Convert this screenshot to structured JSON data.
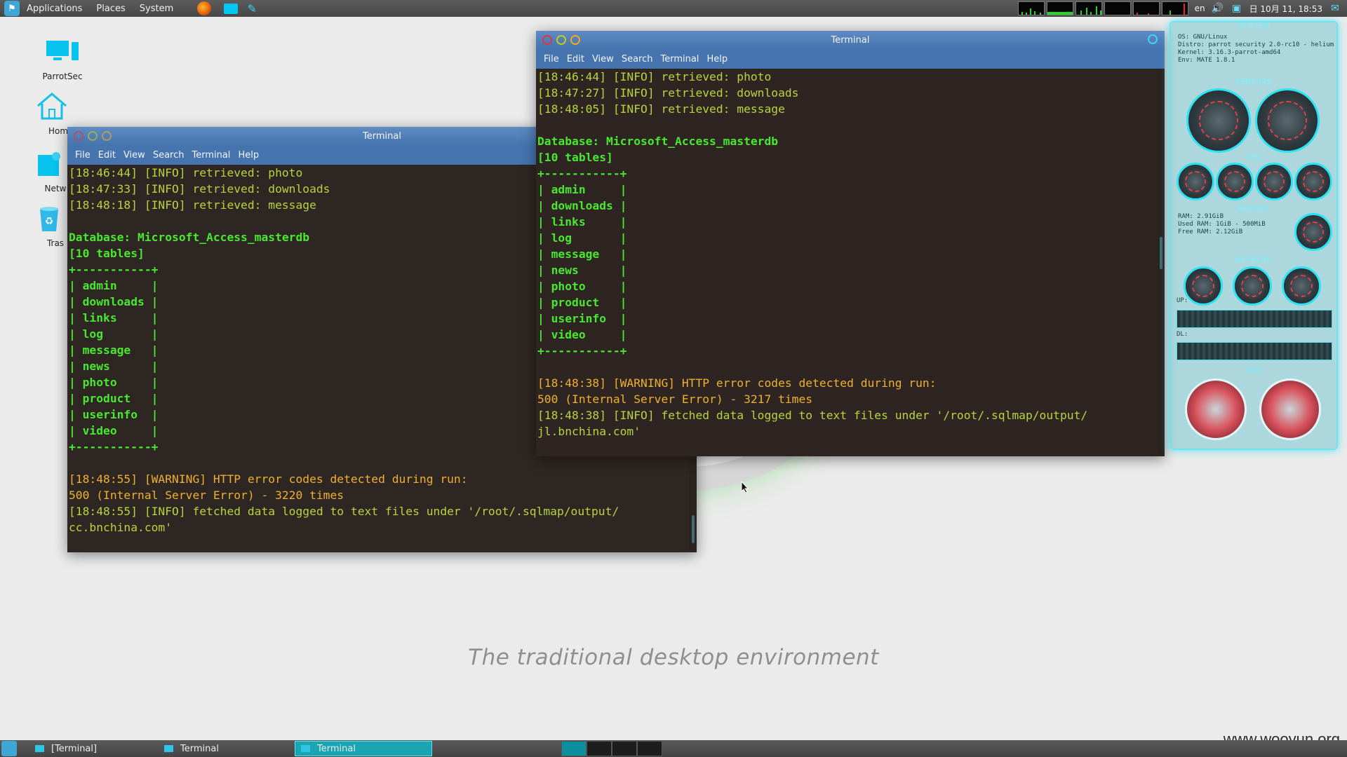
{
  "top_panel": {
    "menus": [
      "Applications",
      "Places",
      "System"
    ],
    "launchers": [
      "firefox-icon",
      "terminal-icon",
      "text-editor-icon"
    ],
    "keyboard_layout": "en",
    "clock": "日 10月 11, 18:53"
  },
  "desktop_icons": [
    {
      "label": "ParrotSec",
      "icon": "computer-icon"
    },
    {
      "label": "Hom",
      "icon": "home-icon"
    },
    {
      "label": "Netw",
      "icon": "network-icon"
    },
    {
      "label": "Tras",
      "icon": "trash-icon"
    }
  ],
  "wallpaper": {
    "tagline": "The traditional desktop environment",
    "watermark": "www.wooyun.org"
  },
  "terminal_menus": [
    "File",
    "Edit",
    "View",
    "Search",
    "Terminal",
    "Help"
  ],
  "terminal_back": {
    "title": "Terminal",
    "lines": [
      {
        "t": "[18:46:44] [INFO] retrieved: photo",
        "c": "info"
      },
      {
        "t": "[18:47:33] [INFO] retrieved: downloads",
        "c": "info"
      },
      {
        "t": "[18:48:18] [INFO] retrieved: message",
        "c": "info"
      },
      {
        "t": "",
        "c": "info"
      },
      {
        "t": "Database: Microsoft_Access_masterdb",
        "c": "green"
      },
      {
        "t": "[10 tables]",
        "c": "green"
      },
      {
        "t": "+-----------+",
        "c": "green"
      },
      {
        "t": "| admin     |",
        "c": "green"
      },
      {
        "t": "| downloads |",
        "c": "green"
      },
      {
        "t": "| links     |",
        "c": "green"
      },
      {
        "t": "| log       |",
        "c": "green"
      },
      {
        "t": "| message   |",
        "c": "green"
      },
      {
        "t": "| news      |",
        "c": "green"
      },
      {
        "t": "| photo     |",
        "c": "green"
      },
      {
        "t": "| product   |",
        "c": "green"
      },
      {
        "t": "| userinfo  |",
        "c": "green"
      },
      {
        "t": "| video     |",
        "c": "green"
      },
      {
        "t": "+-----------+",
        "c": "green"
      },
      {
        "t": "",
        "c": "info"
      },
      {
        "t": "[18:48:55] [WARNING] HTTP error codes detected during run:",
        "c": "warn"
      },
      {
        "t": "500 (Internal Server Error) - 3220 times",
        "c": "warn"
      },
      {
        "t": "[18:48:55] [INFO] fetched data logged to text files under '/root/.sqlmap/output/",
        "c": "info"
      },
      {
        "t": "cc.bnchina.com'",
        "c": "info"
      },
      {
        "t": "",
        "c": "info"
      }
    ]
  },
  "terminal_front": {
    "title": "Terminal",
    "lines": [
      {
        "t": "[18:46:44] [INFO] retrieved: photo",
        "c": "info"
      },
      {
        "t": "[18:47:27] [INFO] retrieved: downloads",
        "c": "info"
      },
      {
        "t": "[18:48:05] [INFO] retrieved: message",
        "c": "info"
      },
      {
        "t": "",
        "c": "info"
      },
      {
        "t": "Database: Microsoft_Access_masterdb",
        "c": "green"
      },
      {
        "t": "[10 tables]",
        "c": "green"
      },
      {
        "t": "+-----------+",
        "c": "green"
      },
      {
        "t": "| admin     |",
        "c": "green"
      },
      {
        "t": "| downloads |",
        "c": "green"
      },
      {
        "t": "| links     |",
        "c": "green"
      },
      {
        "t": "| log       |",
        "c": "green"
      },
      {
        "t": "| message   |",
        "c": "green"
      },
      {
        "t": "| news      |",
        "c": "green"
      },
      {
        "t": "| photo     |",
        "c": "green"
      },
      {
        "t": "| product   |",
        "c": "green"
      },
      {
        "t": "| userinfo  |",
        "c": "green"
      },
      {
        "t": "| video     |",
        "c": "green"
      },
      {
        "t": "+-----------+",
        "c": "green"
      },
      {
        "t": "",
        "c": "info"
      },
      {
        "t": "[18:48:38] [WARNING] HTTP error codes detected during run:",
        "c": "warn"
      },
      {
        "t": "500 (Internal Server Error) - 3217 times",
        "c": "warn"
      },
      {
        "t": "[18:48:38] [INFO] fetched data logged to text files under '/root/.sqlmap/output/",
        "c": "info"
      },
      {
        "t": "jl.bnchina.com'",
        "c": "info"
      }
    ]
  },
  "conky": {
    "sections": [
      "SYSTEM",
      "SENSORS",
      "CPU",
      "MEMORY",
      "NETWORK",
      "HDD"
    ],
    "system_lines": [
      "OS: GNU/Linux",
      "Distro: parrot security 2.0-rc10 - helium",
      "Kernel: 3.16.3-parrot-amd64",
      "Env: MATE 1.8.1"
    ],
    "memory_lines": [
      "RAM: 2.91GiB",
      "Used RAM: 1GiB - 500MiB",
      "Free RAM: 2.12GiB"
    ],
    "network_labels": [
      "UP:",
      "DL:"
    ]
  },
  "bottom_panel": {
    "tasks": [
      "[Terminal]",
      "Terminal",
      "Terminal"
    ],
    "active_task": 2
  },
  "colors": {
    "info": "#b7d43d",
    "green": "#48e82f",
    "warning": "#efb02e",
    "titlebar": "#4574ae",
    "terminal_bg": "#2e2623"
  }
}
